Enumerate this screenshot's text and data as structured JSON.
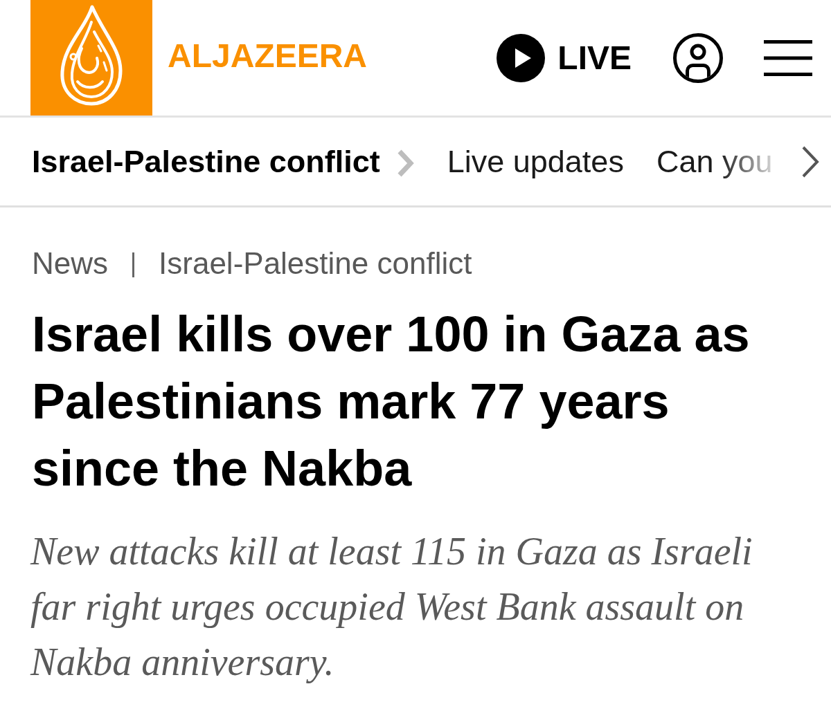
{
  "header": {
    "logo": {
      "wordmark": "ALJAZEERA"
    },
    "live": {
      "label": "LIVE"
    }
  },
  "topic_bar": {
    "items": [
      {
        "label": "Israel-Palestine conflict",
        "kind": "title"
      },
      {
        "label": "Live updates",
        "kind": "link"
      },
      {
        "label": "Can you",
        "kind": "link"
      }
    ]
  },
  "article": {
    "breadcrumb": [
      "News",
      "Israel-Palestine conflict"
    ],
    "headline": "Israel kills over 100 in Gaza as Palestinians mark 77 years since the Nakba",
    "standfirst": "New attacks kill at least 115 in Gaza as Israeli far right urges occupied West Bank assault on Nakba anniversary."
  }
}
